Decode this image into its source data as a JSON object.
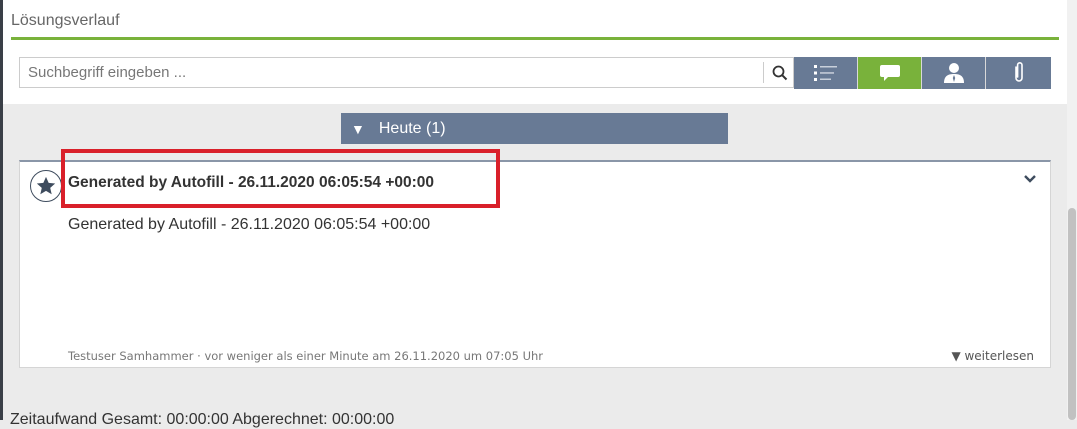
{
  "section": {
    "title": "Lösungsverlauf"
  },
  "search": {
    "placeholder": "Suchbegriff eingeben ..."
  },
  "filters": [
    {
      "name": "list",
      "icon": "list-icon",
      "active": false
    },
    {
      "name": "comments",
      "icon": "speech-bubble-icon",
      "active": true
    },
    {
      "name": "user",
      "icon": "user-icon",
      "active": false
    },
    {
      "name": "attachments",
      "icon": "paperclip-icon",
      "active": false
    }
  ],
  "day_group": {
    "label": "Heute (1)"
  },
  "entry": {
    "title": "Generated by Autofill - 26.11.2020 06:05:54 +00:00",
    "body": "Generated by Autofill - 26.11.2020 06:05:54 +00:00",
    "meta": "Testuser Samhammer · vor weniger als einer Minute am 26.11.2020 um 07:05 Uhr",
    "more_label": "▼ weiterlesen"
  },
  "footer": {
    "partial_text": "Zeitaufwand   Gesamt: 00:00:00   Abgerechnet: 00:00:00"
  },
  "colors": {
    "accent_green": "#79b23b",
    "slate": "#687a95",
    "highlight_red": "#d9202a"
  }
}
